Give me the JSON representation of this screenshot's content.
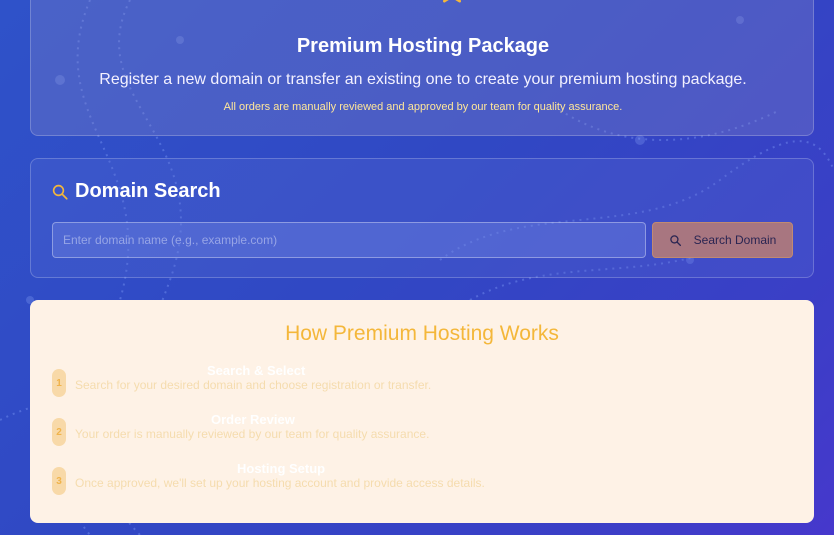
{
  "hero": {
    "title": "Premium Hosting Package",
    "subtitle": "Register a new domain or transfer an existing one to create your premium hosting package.",
    "note": "All orders are manually reviewed and approved by our team for quality assurance.",
    "icon": "star-icon"
  },
  "search": {
    "title": "Domain Search",
    "icon": "search-icon",
    "placeholder": "Enter domain name (e.g., example.com)",
    "value": "",
    "button_label": "Search Domain"
  },
  "how": {
    "title": "How Premium Hosting Works",
    "steps": [
      {
        "number": "1",
        "title": "Search & Select",
        "description": "Search for your desired domain and choose registration or transfer."
      },
      {
        "number": "2",
        "title": "Order Review",
        "description": "Your order is manually reviewed by our team for quality assurance."
      },
      {
        "number": "3",
        "title": "Hosting Setup",
        "description": "Once approved, we'll set up your hosting account and provide access details."
      }
    ]
  },
  "colors": {
    "accent_gold": "#f4b73a",
    "background": "#3048c4",
    "panel_light": "#fef2e6",
    "button": "#a87680"
  }
}
